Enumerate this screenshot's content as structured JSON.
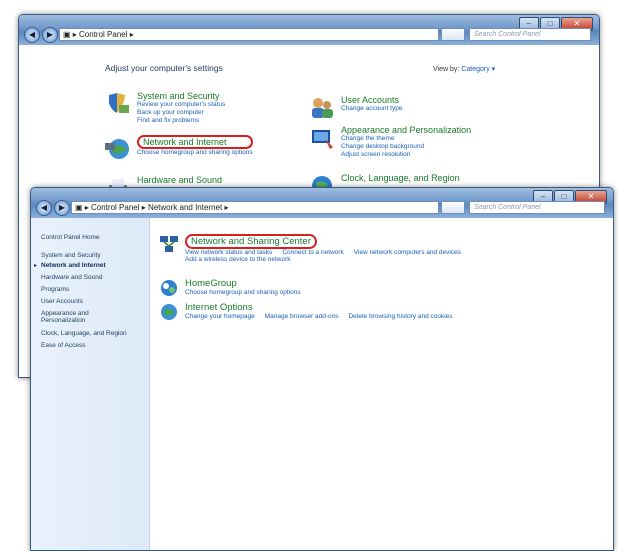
{
  "back_window": {
    "nav_back": "◀",
    "nav_fwd": "▶",
    "address": "▣ ▸ Control Panel ▸",
    "search_placeholder": "Search Control Panel",
    "minimize": "–",
    "maximize": "□",
    "close": "✕",
    "heading": "Adjust your computer's settings",
    "view_by_label": "View by:",
    "view_by_value": "Category ▾",
    "categories": [
      {
        "title": "System and Security",
        "links": [
          "Review your computer's status",
          "Back up your computer",
          "Find and fix problems"
        ]
      },
      {
        "title": "Network and Internet",
        "links": [
          "Choose homegroup and sharing options"
        ]
      },
      {
        "title": "Hardware and Sound",
        "links": []
      },
      {
        "title": "User Accounts",
        "links": [
          "Change account type"
        ]
      },
      {
        "title": "Appearance and Personalization",
        "links": [
          "Change the theme",
          "Change desktop background",
          "Adjust screen resolution"
        ]
      },
      {
        "title": "Clock, Language, and Region",
        "links": []
      }
    ]
  },
  "front_window": {
    "nav_back": "◀",
    "nav_fwd": "▶",
    "address": "▣ ▸ Control Panel ▸ Network and Internet ▸",
    "search_placeholder": "Search Control Panel",
    "minimize": "–",
    "maximize": "□",
    "close": "✕",
    "sidebar": [
      "Control Panel Home",
      "System and Security",
      "Network and Internet",
      "Hardware and Sound",
      "Programs",
      "User Accounts",
      "Appearance and Personalization",
      "Clock, Language, and Region",
      "Ease of Access"
    ],
    "active_marker": "▸",
    "sections": [
      {
        "title": "Network and Sharing Center",
        "links": [
          "View network status and tasks",
          "Connect to a network",
          "View network computers and devices"
        ],
        "sub": "Add a wireless device to the network"
      },
      {
        "title": "HomeGroup",
        "links": [
          "Choose homegroup and sharing options"
        ]
      },
      {
        "title": "Internet Options",
        "links": [
          "Change your homepage",
          "Manage browser add-ons",
          "Delete browsing history and cookies"
        ]
      }
    ]
  }
}
